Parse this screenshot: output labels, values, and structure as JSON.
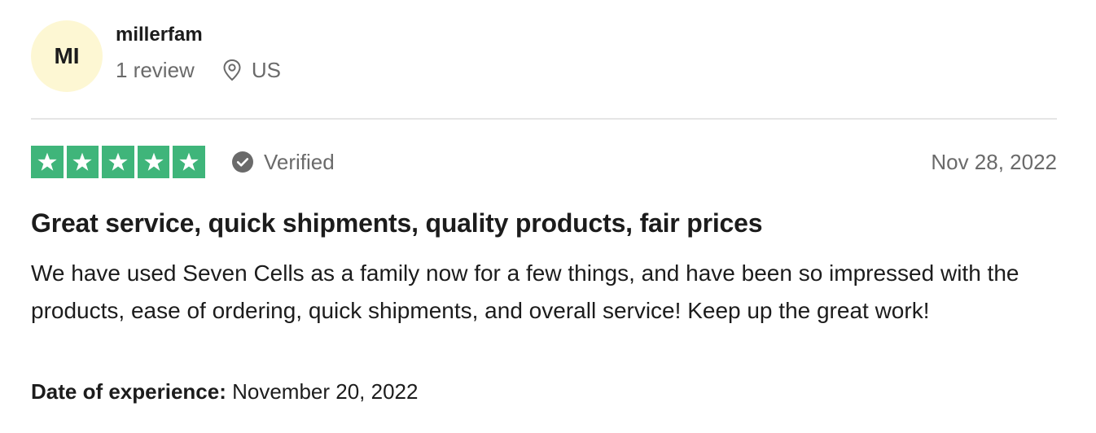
{
  "reviewer": {
    "initials": "MI",
    "name": "millerfam",
    "review_count": "1 review",
    "location": "US",
    "location_icon": "map-pin-icon"
  },
  "rating": {
    "stars": 5,
    "max_stars": 5,
    "star_color": "#3fb57a",
    "verified_label": "Verified",
    "verified_icon": "check-circle-icon",
    "date": "Nov 28, 2022"
  },
  "review": {
    "title": "Great service, quick shipments, quality products, fair prices",
    "body": "We have used Seven Cells as a family now for a few things, and have been so impressed with the products, ease of ordering, quick shipments, and overall service! Keep up the great work!"
  },
  "experience": {
    "label": "Date of experience:",
    "date": "November 20, 2022"
  },
  "colors": {
    "avatar_bg": "#fdf7d3",
    "muted_text": "#6a6a6a",
    "divider": "#e5e5e5"
  }
}
